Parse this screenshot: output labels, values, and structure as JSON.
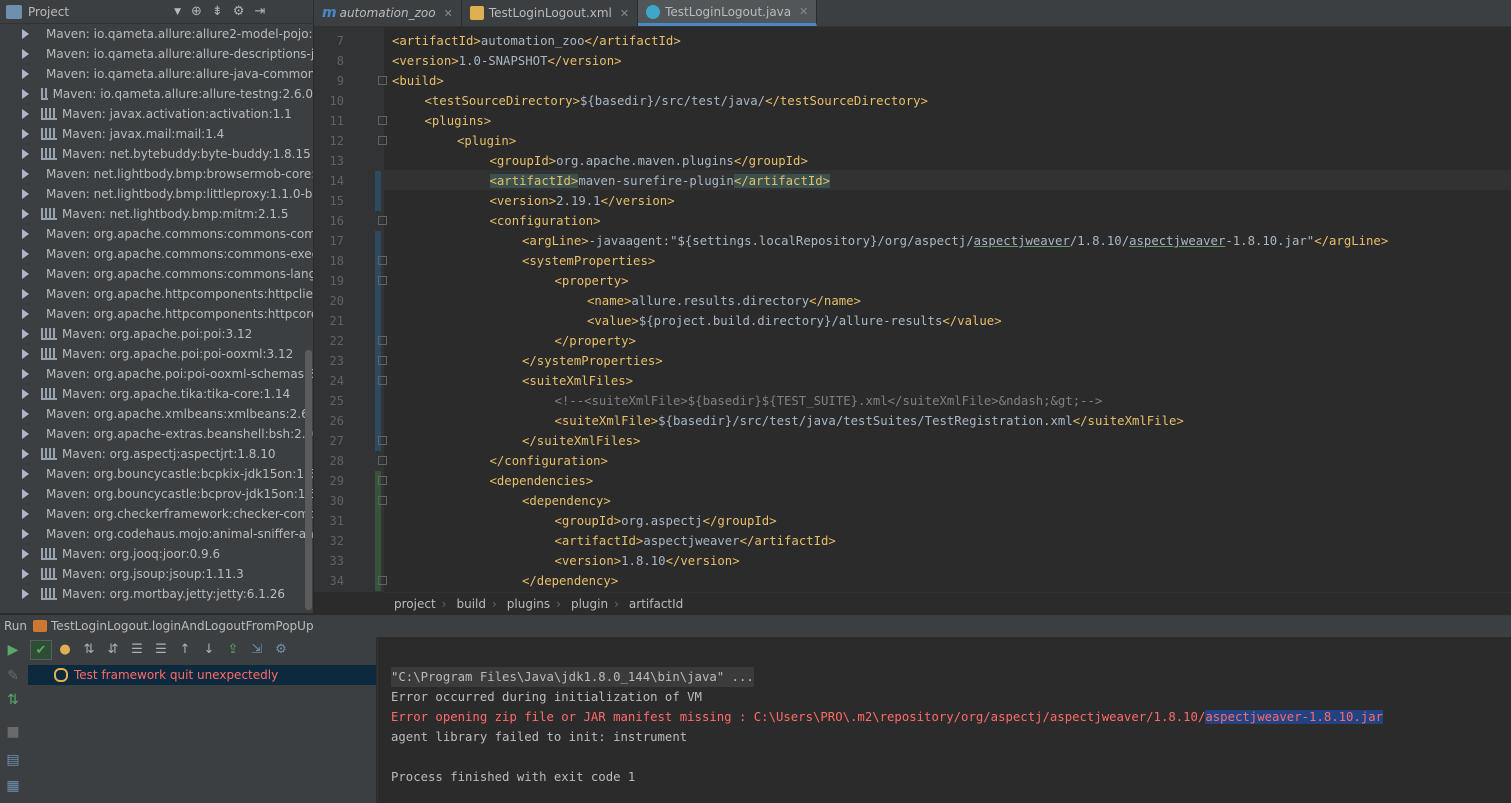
{
  "project_panel": {
    "title": "Project",
    "items": [
      "Maven: io.qameta.allure:allure2-model-pojo:1.0-",
      "Maven: io.qameta.allure:allure-descriptions-java",
      "Maven: io.qameta.allure:allure-java-commons:2",
      "Maven: io.qameta.allure:allure-testng:2.6.0",
      "Maven: javax.activation:activation:1.1",
      "Maven: javax.mail:mail:1.4",
      "Maven: net.bytebuddy:byte-buddy:1.8.15",
      "Maven: net.lightbody.bmp:browsermob-core:2.1",
      "Maven: net.lightbody.bmp:littleproxy:1.1.0-beta-",
      "Maven: net.lightbody.bmp:mitm:2.1.5",
      "Maven: org.apache.commons:commons-compr",
      "Maven: org.apache.commons:commons-exec:1",
      "Maven: org.apache.commons:commons-lang3:3",
      "Maven: org.apache.httpcomponents:httpclient:4",
      "Maven: org.apache.httpcomponents:httpcore:4.",
      "Maven: org.apache.poi:poi:3.12",
      "Maven: org.apache.poi:poi-ooxml:3.12",
      "Maven: org.apache.poi:poi-ooxml-schemas:3.12",
      "Maven: org.apache.tika:tika-core:1.14",
      "Maven: org.apache.xmlbeans:xmlbeans:2.6.0",
      "Maven: org.apache-extras.beanshell:bsh:2.0b6",
      "Maven: org.aspectj:aspectjrt:1.8.10",
      "Maven: org.bouncycastle:bcpkix-jdk15on:1.58",
      "Maven: org.bouncycastle:bcprov-jdk15on:1.58",
      "Maven: org.checkerframework:checker-compat-",
      "Maven: org.codehaus.mojo:animal-sniffer-anno",
      "Maven: org.jooq:joor:0.9.6",
      "Maven: org.jsoup:jsoup:1.11.3",
      "Maven: org.mortbay.jetty:jetty:6.1.26"
    ]
  },
  "tabs": [
    {
      "label": "automation_zoo",
      "icon": "maven-icon",
      "active": false
    },
    {
      "label": "TestLoginLogout.xml",
      "icon": "xml-file-icon",
      "active": false
    },
    {
      "label": "TestLoginLogout.java",
      "icon": "java-class-icon",
      "active": true
    }
  ],
  "editor": {
    "lines": [
      {
        "n": "7",
        "indent": 1,
        "parts": [
          [
            "tg",
            "<artifactId>"
          ],
          [
            "tx",
            "automation_zoo"
          ],
          [
            "tg",
            "</artifactId>"
          ]
        ]
      },
      {
        "n": "8",
        "indent": 1,
        "parts": [
          [
            "tg",
            "<version>"
          ],
          [
            "tx",
            "1.0-SNAPSHOT"
          ],
          [
            "tg",
            "</version>"
          ]
        ]
      },
      {
        "n": "9",
        "indent": 1,
        "parts": [
          [
            "tg",
            "<build>"
          ]
        ]
      },
      {
        "n": "10",
        "indent": 2,
        "parts": [
          [
            "tg",
            "<testSourceDirectory>"
          ],
          [
            "tx",
            "${basedir}/src/test/java/"
          ],
          [
            "tg",
            "</testSourceDirectory>"
          ]
        ]
      },
      {
        "n": "11",
        "indent": 2,
        "parts": [
          [
            "tg",
            "<plugins>"
          ]
        ]
      },
      {
        "n": "12",
        "indent": 3,
        "parts": [
          [
            "tg",
            "<plugin>"
          ]
        ]
      },
      {
        "n": "13",
        "indent": 4,
        "parts": [
          [
            "tg",
            "<groupId>"
          ],
          [
            "tx",
            "org.apache.maven.plugins"
          ],
          [
            "tg",
            "</groupId>"
          ]
        ]
      },
      {
        "n": "14",
        "indent": 4,
        "parts": [
          [
            "tg hl",
            "<artifactId>"
          ],
          [
            "tx",
            "maven-surefire-plugin"
          ],
          [
            "tg hl",
            "</artifactId>"
          ]
        ]
      },
      {
        "n": "15",
        "indent": 4,
        "parts": [
          [
            "tg",
            "<version>"
          ],
          [
            "tx",
            "2.19.1"
          ],
          [
            "tg",
            "</version>"
          ]
        ]
      },
      {
        "n": "16",
        "indent": 4,
        "parts": [
          [
            "tg",
            "<configuration>"
          ]
        ]
      },
      {
        "n": "17",
        "indent": 5,
        "parts": [
          [
            "tg",
            "<argLine>"
          ],
          [
            "tx",
            "-javaagent:\"${settings.localRepository}/org/aspectj/"
          ],
          [
            "tx ul",
            "aspectjweaver"
          ],
          [
            "tx",
            "/1.8.10/"
          ],
          [
            "tx ul",
            "aspectjweaver"
          ],
          [
            "tx",
            "-1.8.10.jar\""
          ],
          [
            "tg",
            "</argLine>"
          ]
        ]
      },
      {
        "n": "18",
        "indent": 5,
        "parts": [
          [
            "tg",
            "<systemProperties>"
          ]
        ]
      },
      {
        "n": "19",
        "indent": 6,
        "parts": [
          [
            "tg",
            "<property>"
          ]
        ]
      },
      {
        "n": "20",
        "indent": 7,
        "parts": [
          [
            "tg",
            "<name>"
          ],
          [
            "tx",
            "allure.results.directory"
          ],
          [
            "tg",
            "</name>"
          ]
        ]
      },
      {
        "n": "21",
        "indent": 7,
        "parts": [
          [
            "tg",
            "<value>"
          ],
          [
            "tx",
            "${project.build.directory}/allure-results"
          ],
          [
            "tg",
            "</value>"
          ]
        ]
      },
      {
        "n": "22",
        "indent": 6,
        "parts": [
          [
            "tg",
            "</property>"
          ]
        ]
      },
      {
        "n": "23",
        "indent": 5,
        "parts": [
          [
            "tg",
            "</systemProperties>"
          ]
        ]
      },
      {
        "n": "24",
        "indent": 5,
        "parts": [
          [
            "tg",
            "<suiteXmlFiles>"
          ]
        ]
      },
      {
        "n": "25",
        "indent": 6,
        "parts": [
          [
            "cm",
            "<!--<suiteXmlFile>${basedir}${TEST_SUITE}.xml</suiteXmlFile>&ndash;&gt;-->"
          ]
        ]
      },
      {
        "n": "26",
        "indent": 6,
        "parts": [
          [
            "tg",
            "<suiteXmlFile>"
          ],
          [
            "tx",
            "${basedir}/src/test/java/testSuites/TestRegistration.xml"
          ],
          [
            "tg",
            "</suiteXmlFile>"
          ]
        ]
      },
      {
        "n": "27",
        "indent": 5,
        "parts": [
          [
            "tg",
            "</suiteXmlFiles>"
          ]
        ]
      },
      {
        "n": "28",
        "indent": 4,
        "parts": [
          [
            "tg",
            "</configuration>"
          ]
        ]
      },
      {
        "n": "29",
        "indent": 4,
        "parts": [
          [
            "tg",
            "<dependencies>"
          ]
        ]
      },
      {
        "n": "30",
        "indent": 5,
        "parts": [
          [
            "tg",
            "<dependency>"
          ]
        ]
      },
      {
        "n": "31",
        "indent": 6,
        "parts": [
          [
            "tg",
            "<groupId>"
          ],
          [
            "tx",
            "org.aspectj"
          ],
          [
            "tg",
            "</groupId>"
          ]
        ]
      },
      {
        "n": "32",
        "indent": 6,
        "parts": [
          [
            "tg",
            "<artifactId>"
          ],
          [
            "tx",
            "aspectjweaver"
          ],
          [
            "tg",
            "</artifactId>"
          ]
        ]
      },
      {
        "n": "33",
        "indent": 6,
        "parts": [
          [
            "tg",
            "<version>"
          ],
          [
            "tx",
            "1.8.10"
          ],
          [
            "tg",
            "</version>"
          ]
        ]
      },
      {
        "n": "34",
        "indent": 5,
        "parts": [
          [
            "tg",
            "</dependency>"
          ]
        ]
      }
    ]
  },
  "breadcrumb": [
    "project",
    "build",
    "plugins",
    "plugin",
    "artifactId"
  ],
  "run_panel": {
    "label": "Run",
    "config_name": "TestLoginLogout.loginAndLogoutFromPopUp",
    "test_status": "Test framework quit unexpectedly"
  },
  "console": {
    "line1": "\"C:\\Program Files\\Java\\jdk1.8.0_144\\bin\\java\" ...",
    "line2": "Error occurred during initialization of VM",
    "line3_prefix": "Error opening zip file or JAR manifest missing : C:\\Users\\PRO\\.m2\\repository/org/aspectj/aspectjweaver/1.8.10/",
    "line3_selected": "aspectjweaver-1.8.10.jar",
    "line4": "agent library failed to init: instrument",
    "line5": "Process finished with exit code 1"
  },
  "colors": {
    "tag": "#e8bf6a",
    "text": "#a9b7c6",
    "error": "#ff6b68",
    "background": "#2b2b2b",
    "panel": "#3c3f41"
  }
}
